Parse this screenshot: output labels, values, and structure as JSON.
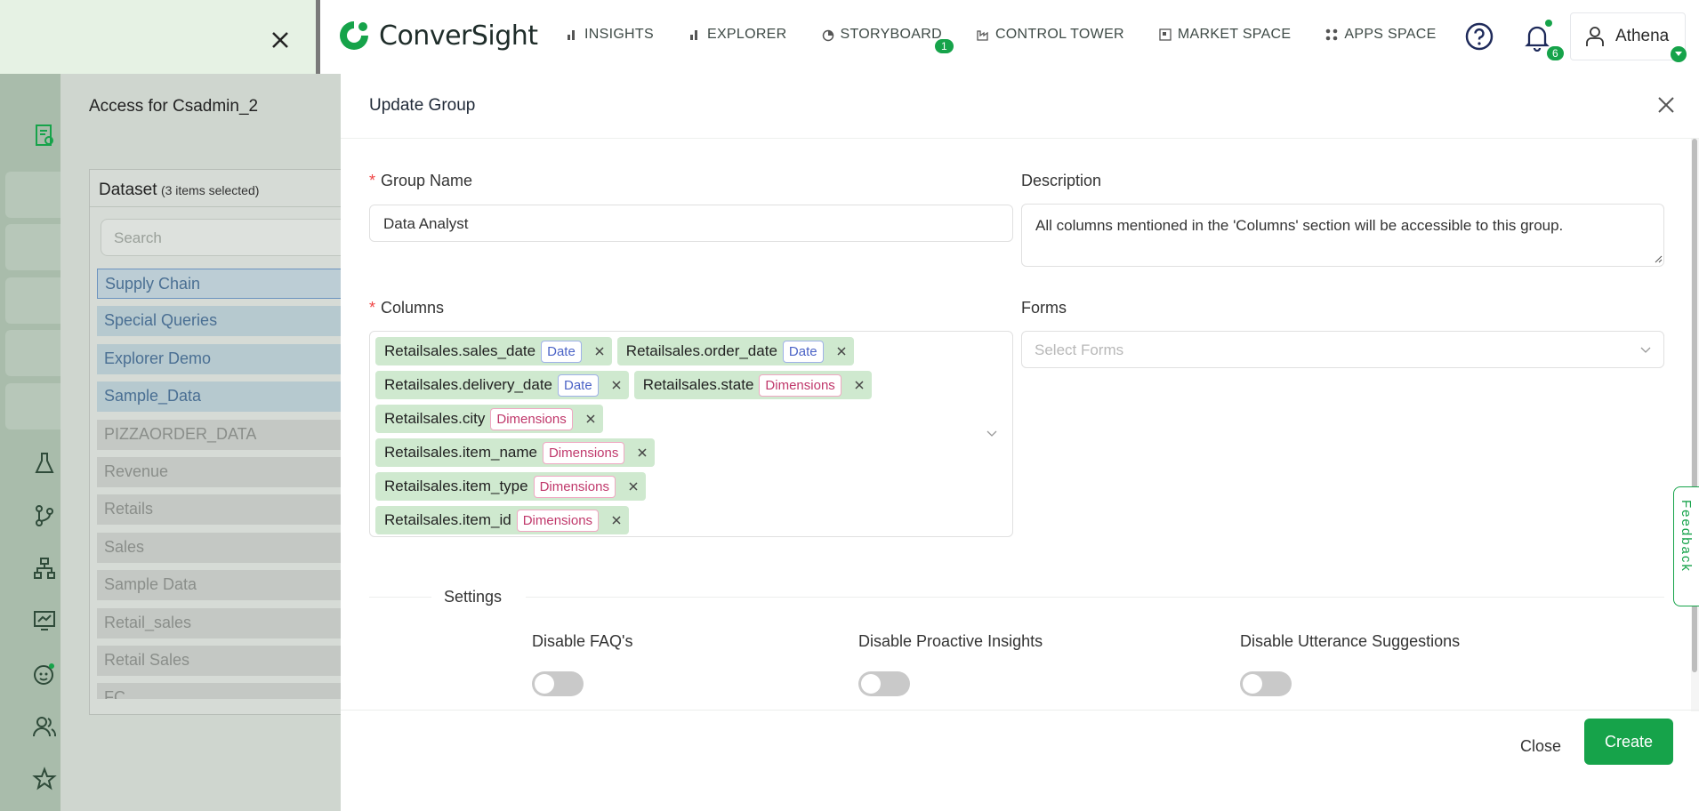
{
  "brand": {
    "name": "ConverSight",
    "accent": "#16a34a"
  },
  "nav": {
    "items": [
      {
        "label": "INSIGHTS",
        "icon": "bar-chart-icon"
      },
      {
        "label": "EXPLORER",
        "icon": "bar-chart-icon"
      },
      {
        "label": "STORYBOARD",
        "icon": "storyboard-icon"
      },
      {
        "label": "CONTROL TOWER",
        "icon": "factory-icon"
      },
      {
        "label": "MARKET SPACE",
        "icon": "market-icon"
      },
      {
        "label": "APPS SPACE",
        "icon": "grid-icon"
      }
    ],
    "storyboard_badge": "1",
    "notifications_badge": "6",
    "user_name": "Athena"
  },
  "access_panel": {
    "title": "Access for Csadmin_2",
    "dataset_heading": "Dataset",
    "dataset_selected": "(3 items selected)",
    "search_placeholder": "Search",
    "items": [
      {
        "label": "Supply Chain",
        "selected": true
      },
      {
        "label": "Special Queries",
        "selected": true
      },
      {
        "label": "Explorer Demo",
        "selected": true
      },
      {
        "label": "Sample_Data",
        "selected": true
      },
      {
        "label": "PIZZAORDER_DATA",
        "selected": false
      },
      {
        "label": "Revenue",
        "selected": false
      },
      {
        "label": "Retails",
        "selected": false
      },
      {
        "label": "Sales",
        "selected": false
      },
      {
        "label": "Sample Data",
        "selected": false
      },
      {
        "label": "Retail_sales",
        "selected": false
      },
      {
        "label": "Retail Sales",
        "selected": false
      },
      {
        "label": "FC",
        "selected": false
      }
    ]
  },
  "modal": {
    "title": "Update Group",
    "group_name_label": "Group Name",
    "group_name_value": "Data Analyst",
    "description_label": "Description",
    "description_value": "All columns mentioned in the 'Columns' section will be accessible to this group.",
    "columns_label": "Columns",
    "columns": [
      [
        {
          "name": "Retailsales.sales_date",
          "type": "Date"
        },
        {
          "name": "Retailsales.order_date",
          "type": "Date"
        }
      ],
      [
        {
          "name": "Retailsales.delivery_date",
          "type": "Date"
        },
        {
          "name": "Retailsales.state",
          "type": "Dimensions"
        }
      ],
      [
        {
          "name": "Retailsales.city",
          "type": "Dimensions"
        }
      ],
      [
        {
          "name": "Retailsales.item_name",
          "type": "Dimensions"
        }
      ],
      [
        {
          "name": "Retailsales.item_type",
          "type": "Dimensions"
        }
      ],
      [
        {
          "name": "Retailsales.item_id",
          "type": "Dimensions"
        }
      ]
    ],
    "forms_label": "Forms",
    "forms_placeholder": "Select Forms",
    "settings_label": "Settings",
    "toggles": [
      {
        "label": "Disable FAQ's",
        "on": false
      },
      {
        "label": "Disable Proactive Insights",
        "on": false
      },
      {
        "label": "Disable Utterance Suggestions",
        "on": false
      }
    ],
    "close_label": "Close",
    "create_label": "Create"
  },
  "feedback_label": "Feedback"
}
